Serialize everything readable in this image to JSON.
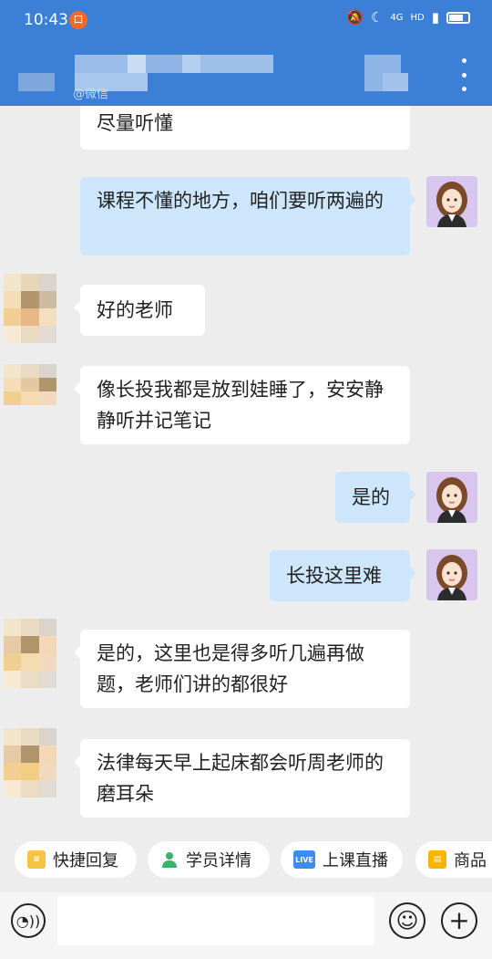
{
  "status_bar": {
    "time": "10:43",
    "notification_badge": "口",
    "network_label": "4G",
    "hd_label": "HD"
  },
  "header": {
    "subtitle": "@微信"
  },
  "messages": [
    {
      "side": "left",
      "text": "尽量听懂"
    },
    {
      "side": "right",
      "text": "课程不懂的地方，咱们要听两遍的"
    },
    {
      "side": "left",
      "text": "好的老师"
    },
    {
      "side": "left",
      "text": "像长投我都是放到娃睡了，安安静静听并记笔记"
    },
    {
      "side": "right",
      "text": "是的"
    },
    {
      "side": "right",
      "text": "长投这里难"
    },
    {
      "side": "left",
      "text": "是的，这里也是得多听几遍再做题，老师们讲的都很好"
    },
    {
      "side": "left",
      "text": "法律每天早上起床都会听周老师的磨耳朵"
    }
  ],
  "quick_actions": [
    {
      "label": "快捷回复",
      "icon": "quick-reply-icon"
    },
    {
      "label": "学员详情",
      "icon": "student-icon"
    },
    {
      "label": "上课直播",
      "icon": "live-icon",
      "icon_text": "LIVE"
    },
    {
      "label": "商品",
      "icon": "product-icon"
    }
  ],
  "input": {
    "placeholder": "",
    "value": ""
  },
  "colors": {
    "header": "#3b7fd6",
    "right_bubble": "#cde6fb",
    "left_bubble": "#ffffff",
    "background": "#ededed"
  }
}
